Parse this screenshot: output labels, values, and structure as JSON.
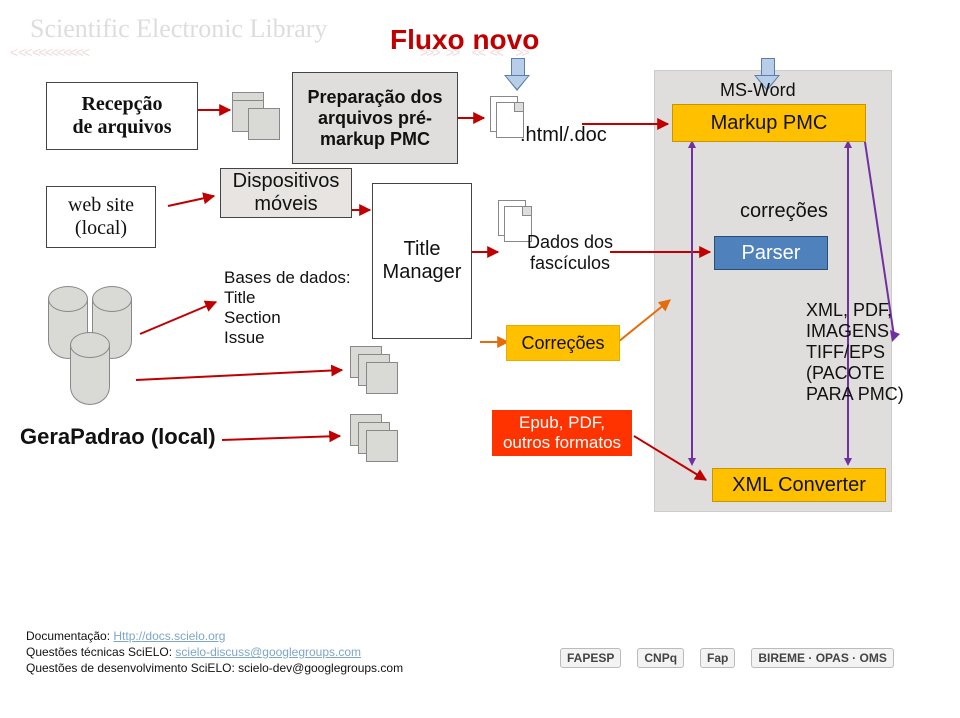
{
  "title": "Fluxo novo",
  "watermark": "Scientific Electronic Library",
  "blocks": {
    "recepcao_l1": "Recepção",
    "recepcao_l2": "de arquivos",
    "website_l1": "web site",
    "website_l2": "(local)",
    "dispositivos_l1": "Dispositivos",
    "dispositivos_l2": "móveis",
    "bases_heading": "Bases de dados:",
    "bases_items": [
      "Title",
      "Section",
      "Issue"
    ],
    "prep_l1": "Preparação dos",
    "prep_l2": "arquivos pré-",
    "prep_l3": "markup PMC",
    "title_manager_l1": "Title",
    "title_manager_l2": "Manager",
    "htmldoc": ".html/.doc",
    "dados_l1": "Dados dos",
    "dados_l2": "fascículos",
    "correcoes_box": "Correções",
    "epub_l1": "Epub, PDF,",
    "epub_l2": "outros formatos",
    "gerapadrao": "GeraPadrao (local)",
    "msword": "MS-Word",
    "markup": "Markup PMC",
    "correcoes_label": "correções",
    "parser": "Parser",
    "xml_output": [
      "XML, PDF,",
      "IMAGENS",
      "TIFF/EPS",
      "(PACOTE",
      "PARA PMC)"
    ],
    "xml_converter": "XML Converter"
  },
  "footer": {
    "doc_label": "Documentação: ",
    "doc_link": "Http://docs.scielo.org",
    "q1_label": "Questões técnicas SciELO: ",
    "q1_link": "scielo-discuss@googlegroups.com",
    "q2_label": "Questões de desenvolvimento SciELO: ",
    "q2_text": "scielo-dev@googlegroups.com"
  },
  "logos": [
    "FAPESP",
    "CNPq",
    "Fap",
    "BIREME · OPAS · OMS"
  ]
}
